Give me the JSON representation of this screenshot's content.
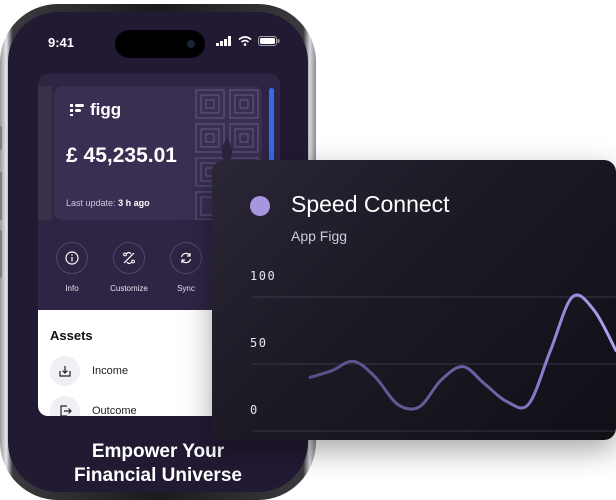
{
  "status_bar": {
    "time": "9:41"
  },
  "card": {
    "brand": "figg",
    "balance": "£ 45,235.01",
    "last_update_label": "Last update:",
    "last_update_value": "3 h ago"
  },
  "actions": [
    {
      "label": "Info",
      "icon": "info-icon"
    },
    {
      "label": "Customize",
      "icon": "customize-icon"
    },
    {
      "label": "Sync",
      "icon": "sync-icon"
    }
  ],
  "assets": {
    "title": "Assets",
    "items": [
      {
        "label": "Income",
        "icon": "income-icon"
      },
      {
        "label": "Outcome",
        "icon": "outcome-icon"
      }
    ]
  },
  "tagline": {
    "line1": "Empower Your",
    "line2": "Financial Universe"
  },
  "widget": {
    "title": "Speed Connect",
    "subtitle": "App Figg",
    "accent": "#a796df"
  },
  "chart_data": {
    "type": "line",
    "title": "Speed Connect",
    "subtitle": "App Figg",
    "xlabel": "",
    "ylabel": "",
    "ylim": [
      0,
      100
    ],
    "yticks": [
      "100",
      "50",
      "0"
    ],
    "grid": true,
    "x": [
      0,
      1,
      2,
      3,
      4,
      5,
      6,
      7,
      8,
      9,
      10,
      11,
      12,
      13,
      14
    ],
    "series": [
      {
        "values": [
          40,
          45,
          52,
          40,
          20,
          18,
          38,
          48,
          35,
          22,
          20,
          60,
          100,
          90,
          60
        ]
      }
    ]
  },
  "colors": {
    "phone_screen": "#221a33",
    "accent_blue": "#2f6df0",
    "line": "#8e7fcf"
  }
}
